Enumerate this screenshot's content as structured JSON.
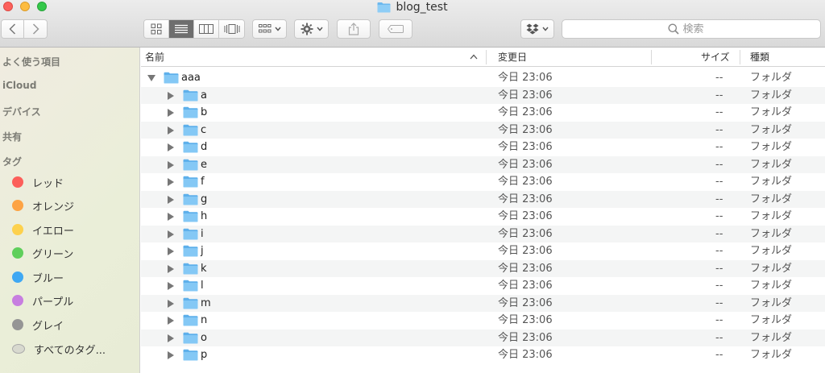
{
  "window": {
    "title": "blog_test"
  },
  "toolbar": {
    "search_placeholder": "検索"
  },
  "sidebar": {
    "sections": [
      {
        "label": "よく使う項目"
      },
      {
        "label": "iCloud"
      },
      {
        "label": "デバイス"
      },
      {
        "label": "共有"
      },
      {
        "label": "タグ"
      }
    ],
    "tags": [
      {
        "label": "レッド",
        "color": "#fc5f5a"
      },
      {
        "label": "オレンジ",
        "color": "#fda344"
      },
      {
        "label": "イエロー",
        "color": "#fdd14d"
      },
      {
        "label": "グリーン",
        "color": "#5fcf5b"
      },
      {
        "label": "ブルー",
        "color": "#3fa8f3"
      },
      {
        "label": "パープル",
        "color": "#c77ee0"
      },
      {
        "label": "グレイ",
        "color": "#959595"
      },
      {
        "label": "すべてのタグ...",
        "color": "#d8d9cf"
      }
    ]
  },
  "columns": {
    "name": "名前",
    "modified": "変更日",
    "size": "サイズ",
    "kind": "種類"
  },
  "rows": [
    {
      "name": "aaa",
      "modified": "今日 23:06",
      "size": "--",
      "kind": "フォルダ"
    },
    {
      "name": "a",
      "modified": "今日 23:06",
      "size": "--",
      "kind": "フォルダ"
    },
    {
      "name": "b",
      "modified": "今日 23:06",
      "size": "--",
      "kind": "フォルダ"
    },
    {
      "name": "c",
      "modified": "今日 23:06",
      "size": "--",
      "kind": "フォルダ"
    },
    {
      "name": "d",
      "modified": "今日 23:06",
      "size": "--",
      "kind": "フォルダ"
    },
    {
      "name": "e",
      "modified": "今日 23:06",
      "size": "--",
      "kind": "フォルダ"
    },
    {
      "name": "f",
      "modified": "今日 23:06",
      "size": "--",
      "kind": "フォルダ"
    },
    {
      "name": "g",
      "modified": "今日 23:06",
      "size": "--",
      "kind": "フォルダ"
    },
    {
      "name": "h",
      "modified": "今日 23:06",
      "size": "--",
      "kind": "フォルダ"
    },
    {
      "name": "i",
      "modified": "今日 23:06",
      "size": "--",
      "kind": "フォルダ"
    },
    {
      "name": "j",
      "modified": "今日 23:06",
      "size": "--",
      "kind": "フォルダ"
    },
    {
      "name": "k",
      "modified": "今日 23:06",
      "size": "--",
      "kind": "フォルダ"
    },
    {
      "name": "l",
      "modified": "今日 23:06",
      "size": "--",
      "kind": "フォルダ"
    },
    {
      "name": "m",
      "modified": "今日 23:06",
      "size": "--",
      "kind": "フォルダ"
    },
    {
      "name": "n",
      "modified": "今日 23:06",
      "size": "--",
      "kind": "フォルダ"
    },
    {
      "name": "o",
      "modified": "今日 23:06",
      "size": "--",
      "kind": "フォルダ"
    },
    {
      "name": "p",
      "modified": "今日 23:06",
      "size": "--",
      "kind": "フォルダ"
    }
  ]
}
